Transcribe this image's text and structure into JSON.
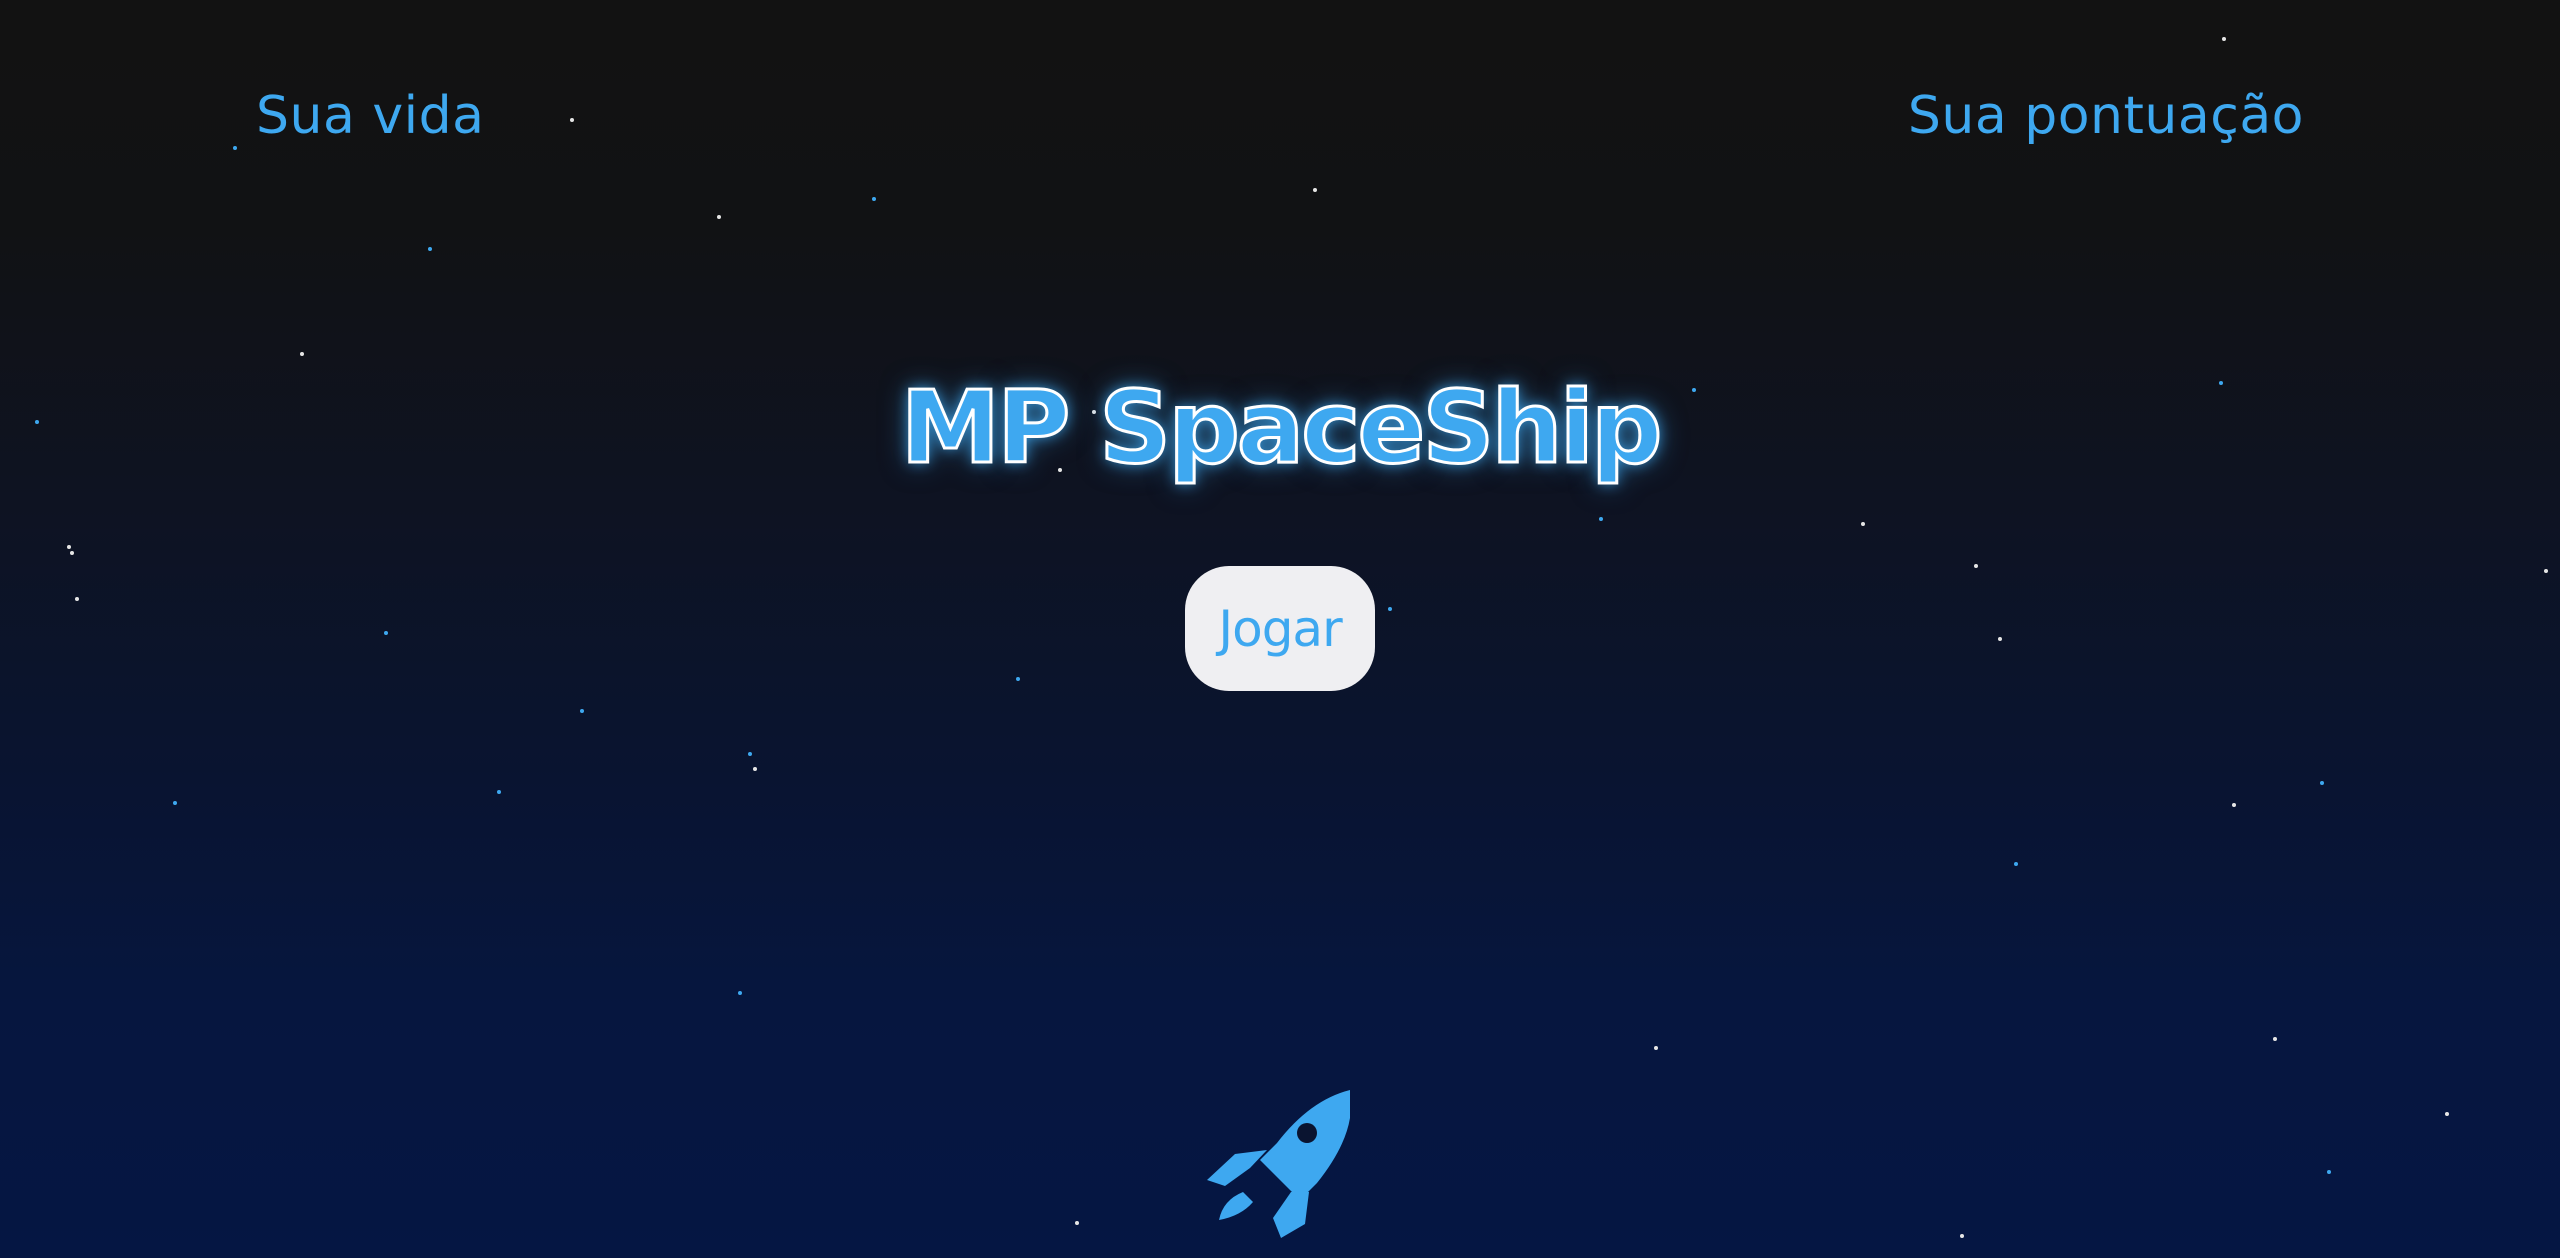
{
  "hud": {
    "life_label": "Sua vida",
    "score_label": "Sua pontuação"
  },
  "title": "MP SpaceShip",
  "play_button_label": "Jogar",
  "player_ship_icon": "rocket-icon",
  "colors": {
    "accent": "#3ea8f0",
    "button_bg": "#efeff2",
    "star_white": "#e6e6e6",
    "star_blue": "#3ea8f0",
    "bg_top": "#121212",
    "bg_bottom": "#051643"
  }
}
